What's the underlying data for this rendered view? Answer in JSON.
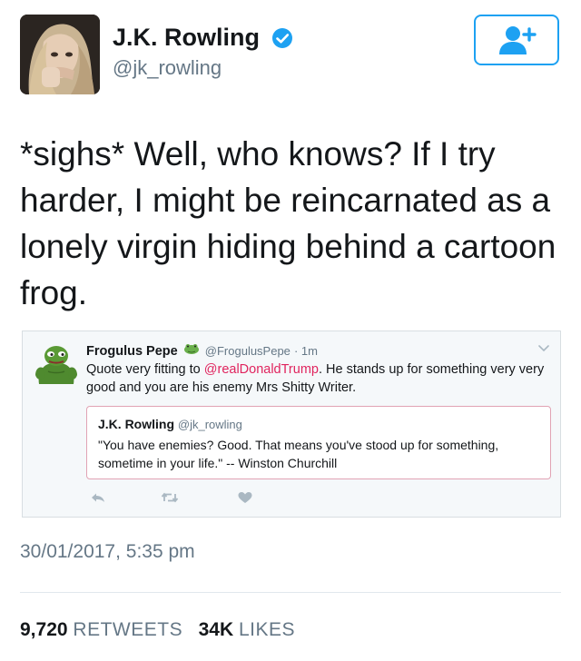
{
  "author": {
    "name": "J.K. Rowling",
    "handle": "@jk_rowling"
  },
  "tweet": {
    "text": "*sighs* Well, who knows? If I try harder, I might be reincarnated as a lonely virgin hiding behind a cartoon frog.",
    "timestamp": "30/01/2017, 5:35 pm"
  },
  "quoted": {
    "name": "Frogulus Pepe",
    "handle": "@FrogulusPepe",
    "time": "· 1m",
    "text_before": "Quote very fitting to ",
    "mention": "@realDonaldTrump",
    "text_after": ". He stands up for something very very good and you are his enemy Mrs Shitty Writer.",
    "inner": {
      "name": "J.K. Rowling",
      "handle": "@jk_rowling",
      "text": "\"You have enemies? Good. That means you've stood up for something, sometime in your life.\" -- Winston Churchill"
    }
  },
  "stats": {
    "retweets_count": "9,720",
    "retweets_label": "RETWEETS",
    "likes_count": "34K",
    "likes_label": "LIKES"
  },
  "colors": {
    "accent": "#1da1f2",
    "mention": "#e0245e",
    "muted": "#657786"
  },
  "icons": [
    "verified-badge-icon",
    "follow-user-icon",
    "frog-emoji-icon",
    "chevron-down-icon",
    "reply-icon",
    "retweet-icon",
    "like-icon"
  ]
}
